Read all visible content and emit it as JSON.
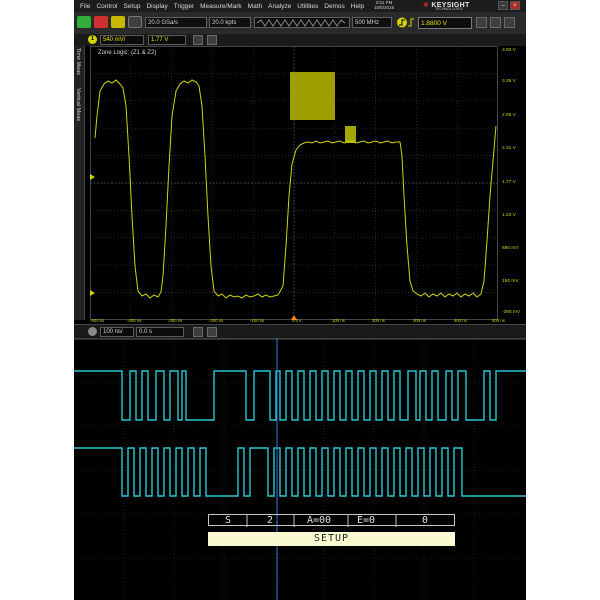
{
  "menu": {
    "items": [
      "File",
      "Control",
      "Setup",
      "Display",
      "Trigger",
      "Measure/Mark",
      "Math",
      "Analyze",
      "Utilities",
      "Demos",
      "Help"
    ],
    "time": "3:51 PM",
    "date": "10/5/2015"
  },
  "logo": {
    "name": "KEYSIGHT",
    "sub": "TECHNOLOGIES"
  },
  "toolbar": {
    "sample_rate": "20.0 GSa/s",
    "memory": "20.0 kpts",
    "bandwidth": "500 MHz",
    "trigger_level": "1.8800 V"
  },
  "channel": {
    "number": "1",
    "scale": "540 mV/",
    "offset": "1.77 V"
  },
  "side_tabs": [
    "Time Meas",
    "Vertical Meas"
  ],
  "zone_label": "Zone Logic:  (Z1 & Z2)",
  "y_labels": [
    "3.93 V",
    "3.39 V",
    "2.85 V",
    "2.31 V",
    "1.77 V",
    "1.23 V",
    "690 mV",
    "150 mV",
    "-390 mV"
  ],
  "x_labels": [
    "-500 ns",
    "-400 ns",
    "-300 ns",
    "-200 ns",
    "-100 ns",
    "0.0 s",
    "100 ns",
    "200 ns",
    "300 ns",
    "400 ns",
    "500 ns"
  ],
  "timebase": {
    "scale": "100 ns/",
    "position": "0.0 s"
  },
  "decode": {
    "cells": [
      "S",
      "2",
      "A=00",
      "E=0",
      "0"
    ],
    "label": "SETUP"
  },
  "colors": {
    "analog": "#d4d400",
    "digital": "#28c8d2",
    "cursor": "#3a7ad8",
    "zone": "#b8b800"
  }
}
